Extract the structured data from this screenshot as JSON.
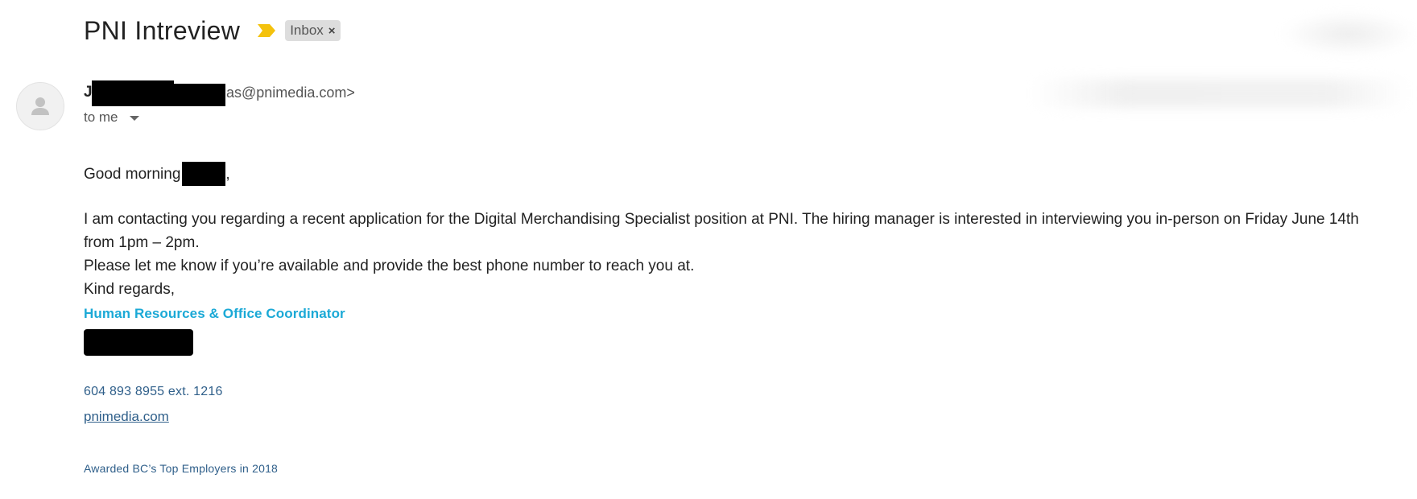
{
  "subject": {
    "title": "PNI Intreview",
    "label_chip": "Inbox",
    "label_remove": "×",
    "importance_color": "#f4c20d"
  },
  "sender": {
    "initial": "J",
    "email_tail": "as@pnimedia.com>",
    "to_line": "to me"
  },
  "body": {
    "greeting": "Good morning",
    "greeting_tail": ",",
    "paragraph_line1": "I am contacting you regarding a recent application for the Digital Merchandising Specialist position at PNI. The hiring manager is interested in interviewing you in-person on Friday June 14th",
    "paragraph_line2": "from 1pm – 2pm.",
    "line3": "Please let me know if you’re available and provide the best phone number to reach you at.",
    "closing": "Kind regards,"
  },
  "signature": {
    "title": "Human Resources & Office Coordinator",
    "phone": "604 893 8955 ext. 1216",
    "website": "pnimedia.com",
    "award": "Awarded BC’s Top Employers in 2018",
    "accent_color": "#1ba9d6",
    "link_color": "#2f5f8a"
  },
  "icons": {
    "importance": "importance-marker-icon",
    "avatar": "person-icon",
    "caret": "chevron-down-icon"
  }
}
